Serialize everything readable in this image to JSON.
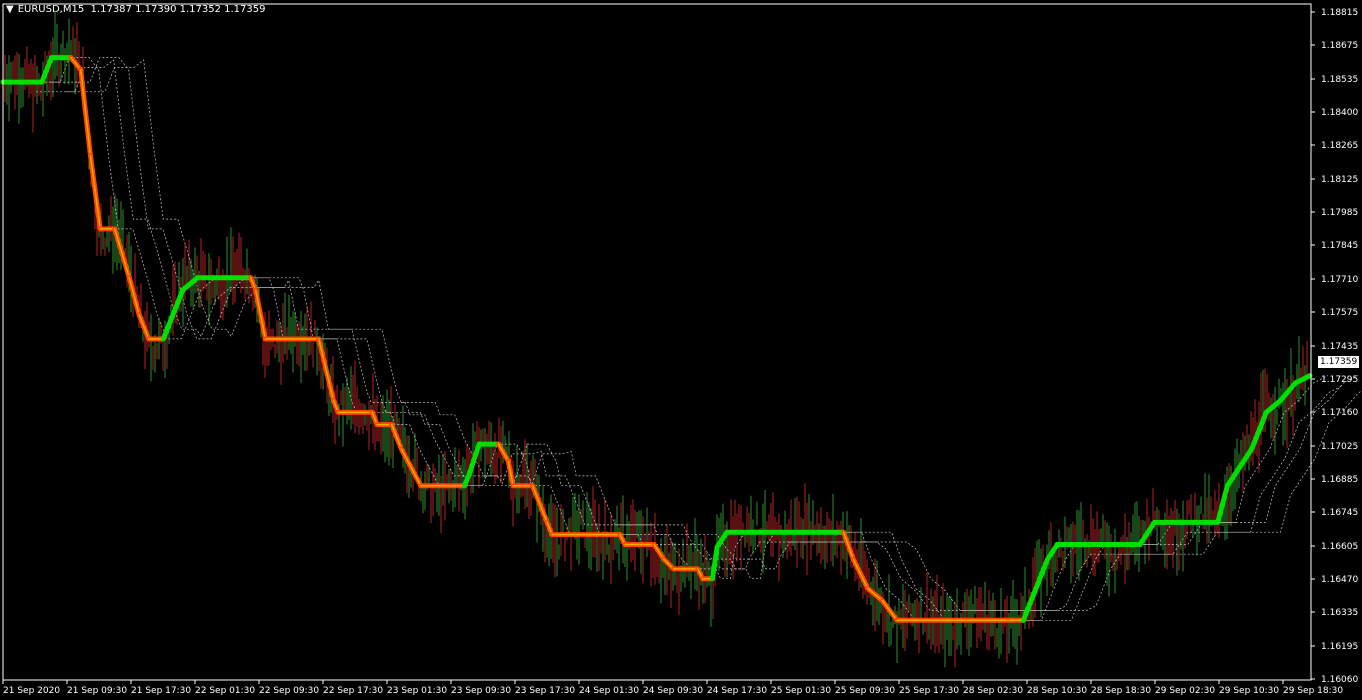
{
  "symbol": "EURUSD,M15",
  "ohlc": "1.17387 1.17390 1.17352 1.17359",
  "last_price_label": "1.17359",
  "colors": {
    "background": "#000000",
    "axis": "#ffffff",
    "candle_up": "#2e8b2e",
    "candle_down": "#b22222",
    "trend_up": "#00e000",
    "trend_down": "#ff4500",
    "trend_down_core": "#ffa500",
    "bands": "#c8c8c8"
  },
  "chart_data": {
    "type": "line",
    "title": "",
    "ylim": [
      1.1606,
      1.18815
    ],
    "y_ticks": [
      "1.18815",
      "1.18675",
      "1.18535",
      "1.18400",
      "1.18265",
      "1.18125",
      "1.17985",
      "1.17845",
      "1.17710",
      "1.17575",
      "1.17435",
      "1.17295",
      "1.17160",
      "1.17025",
      "1.16885",
      "1.16745",
      "1.16605",
      "1.16470",
      "1.16335",
      "1.16195",
      "1.16060"
    ],
    "x_ticks": [
      "21 Sep 2020",
      "21 Sep 09:30",
      "21 Sep 17:30",
      "22 Sep 01:30",
      "22 Sep 09:30",
      "22 Sep 17:30",
      "23 Sep 01:30",
      "23 Sep 09:30",
      "23 Sep 17:30",
      "24 Sep 01:30",
      "24 Sep 09:30",
      "24 Sep 17:30",
      "25 Sep 01:30",
      "25 Sep 09:30",
      "25 Sep 17:30",
      "28 Sep 02:30",
      "28 Sep 10:30",
      "28 Sep 18:30",
      "29 Sep 02:30",
      "29 Sep 10:30",
      "29 Sep 18:30"
    ],
    "trend_line": [
      [
        0,
        1.185,
        "up"
      ],
      [
        0.04,
        1.185,
        "up"
      ],
      [
        0.05,
        1.186,
        "up"
      ],
      [
        0.07,
        1.186,
        "up"
      ],
      [
        0.08,
        1.1855,
        "down"
      ],
      [
        0.09,
        1.182,
        "down"
      ],
      [
        0.1,
        1.179,
        "down"
      ],
      [
        0.115,
        1.179,
        "down"
      ],
      [
        0.13,
        1.177,
        "down"
      ],
      [
        0.14,
        1.1755,
        "down"
      ],
      [
        0.15,
        1.1745,
        "down"
      ],
      [
        0.165,
        1.1745,
        "down"
      ],
      [
        0.17,
        1.175,
        "up"
      ],
      [
        0.185,
        1.1765,
        "up"
      ],
      [
        0.2,
        1.177,
        "up"
      ],
      [
        0.255,
        1.177,
        "up"
      ],
      [
        0.26,
        1.1765,
        "down"
      ],
      [
        0.27,
        1.1745,
        "down"
      ],
      [
        0.325,
        1.1745,
        "down"
      ],
      [
        0.34,
        1.172,
        "down"
      ],
      [
        0.345,
        1.1715,
        "down"
      ],
      [
        0.38,
        1.1715,
        "down"
      ],
      [
        0.385,
        1.171,
        "down"
      ],
      [
        0.4,
        1.171,
        "down"
      ],
      [
        0.41,
        1.17,
        "down"
      ],
      [
        0.43,
        1.1685,
        "down"
      ],
      [
        0.475,
        1.1685,
        "down"
      ],
      [
        0.48,
        1.169,
        "up"
      ],
      [
        0.49,
        1.1702,
        "up"
      ],
      [
        0.51,
        1.1702,
        "up"
      ],
      [
        0.52,
        1.1695,
        "down"
      ],
      [
        0.525,
        1.1685,
        "down"
      ],
      [
        0.545,
        1.1685,
        "down"
      ],
      [
        0.56,
        1.167,
        "down"
      ],
      [
        0.565,
        1.1665,
        "down"
      ],
      [
        0.635,
        1.1665,
        "down"
      ],
      [
        0.64,
        1.1661,
        "down"
      ],
      [
        0.67,
        1.1661,
        "down"
      ],
      [
        0.68,
        1.1655,
        "down"
      ],
      [
        0.69,
        1.1651,
        "down"
      ],
      [
        0.715,
        1.1651,
        "down"
      ],
      [
        0.72,
        1.1647,
        "down"
      ],
      [
        0.73,
        1.1647,
        "down"
      ],
      [
        0.735,
        1.166,
        "up"
      ],
      [
        0.745,
        1.1666,
        "up"
      ],
      [
        0.865,
        1.1666,
        "up"
      ],
      [
        0.875,
        1.1655,
        "down"
      ],
      [
        0.89,
        1.1643,
        "down"
      ],
      [
        0.905,
        1.1638,
        "down"
      ],
      [
        0.92,
        1.163,
        "down"
      ],
      [
        1.05,
        1.163,
        "down"
      ],
      [
        1.06,
        1.164,
        "up"
      ],
      [
        1.075,
        1.1655,
        "up"
      ],
      [
        1.085,
        1.1661,
        "up"
      ],
      [
        1.17,
        1.1661,
        "up"
      ],
      [
        1.185,
        1.167,
        "up"
      ],
      [
        1.25,
        1.167,
        "up"
      ],
      [
        1.26,
        1.1685,
        "up"
      ],
      [
        1.285,
        1.17,
        "up"
      ],
      [
        1.3,
        1.1715,
        "up"
      ],
      [
        1.315,
        1.172,
        "up"
      ],
      [
        1.33,
        1.1727,
        "up"
      ],
      [
        1.345,
        1.173,
        "up"
      ]
    ]
  }
}
